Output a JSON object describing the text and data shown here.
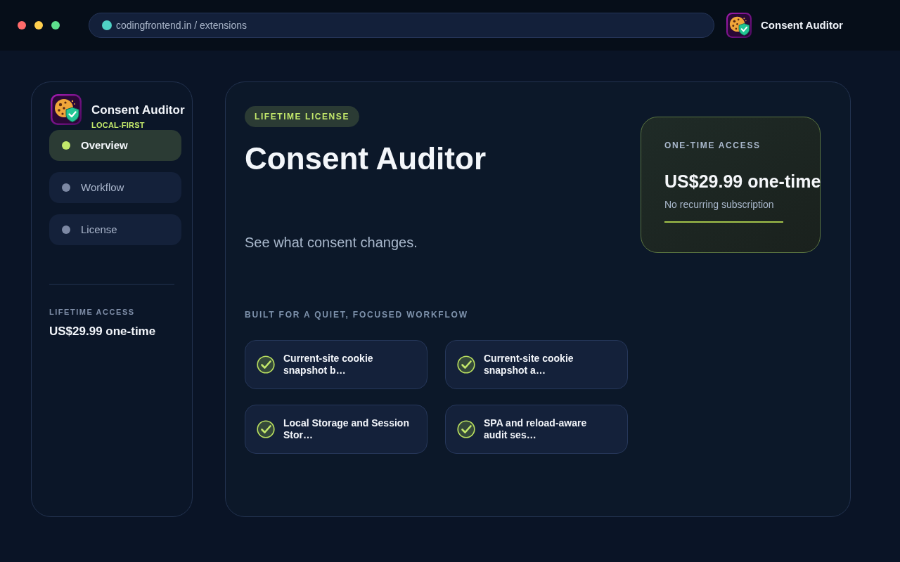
{
  "window_controls": [
    {
      "color": "#ff6b6b"
    },
    {
      "color": "#ffcf4e"
    },
    {
      "color": "#5ee08e"
    }
  ],
  "address_bar": {
    "url": "codingfrontend.in / extensions"
  },
  "app": {
    "name": "Consent Auditor"
  },
  "sidebar": {
    "app_name": "Consent Auditor",
    "tagline": "LOCAL-FIRST",
    "nav": [
      {
        "label": "Overview",
        "selected": true
      },
      {
        "label": "Workflow",
        "selected": false
      },
      {
        "label": "License",
        "selected": false
      }
    ],
    "access_label": "LIFETIME ACCESS",
    "price": "US$29.99 one-time"
  },
  "main": {
    "badge": "LIFETIME LICENSE",
    "title": "Consent Auditor",
    "subtitle": "See what consent changes.",
    "section_label": "BUILT FOR A QUIET, FOCUSED WORKFLOW",
    "features": [
      {
        "text": "Current-site cookie snapshot b…"
      },
      {
        "text": "Current-site cookie snapshot a…"
      },
      {
        "text": "Local Storage and Session Stor…"
      },
      {
        "text": "SPA and reload-aware audit ses…"
      }
    ]
  },
  "price_card": {
    "label": "ONE-TIME ACCESS",
    "price": "US$29.99 one-time",
    "note": "No recurring subscription"
  }
}
